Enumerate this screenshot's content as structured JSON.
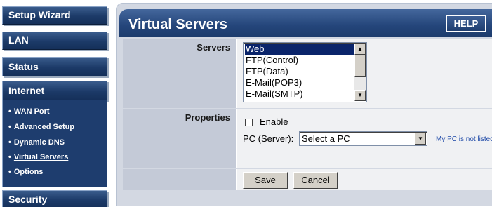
{
  "sidebar": {
    "menu": [
      {
        "label": "Setup Wizard"
      },
      {
        "label": "LAN"
      },
      {
        "label": "Status"
      },
      {
        "label": "Internet"
      },
      {
        "label": "Security"
      }
    ],
    "internet_submenu": [
      {
        "label": "WAN Port",
        "active": false
      },
      {
        "label": "Advanced Setup",
        "active": false
      },
      {
        "label": "Dynamic DNS",
        "active": false
      },
      {
        "label": "Virtual Servers",
        "active": true
      },
      {
        "label": "Options",
        "active": false
      }
    ],
    "bullet": "•"
  },
  "header": {
    "title": "Virtual Servers",
    "help_label": "HELP"
  },
  "servers": {
    "label": "Servers",
    "options": [
      "Web",
      "FTP(Control)",
      "FTP(Data)",
      "E-Mail(POP3)",
      "E-Mail(SMTP)"
    ],
    "selected": "Web"
  },
  "properties": {
    "label": "Properties",
    "enable_label": "Enable",
    "enable_checked": false,
    "pc_label": "PC (Server):",
    "pc_value": "Select a PC",
    "pc_not_listed_link": "My PC is not listed"
  },
  "actions": {
    "save_label": "Save",
    "cancel_label": "Cancel"
  },
  "colors": {
    "nav_blue": "#1c3a68",
    "list_selected": "#0a246a",
    "link_blue": "#1f4aa8"
  }
}
